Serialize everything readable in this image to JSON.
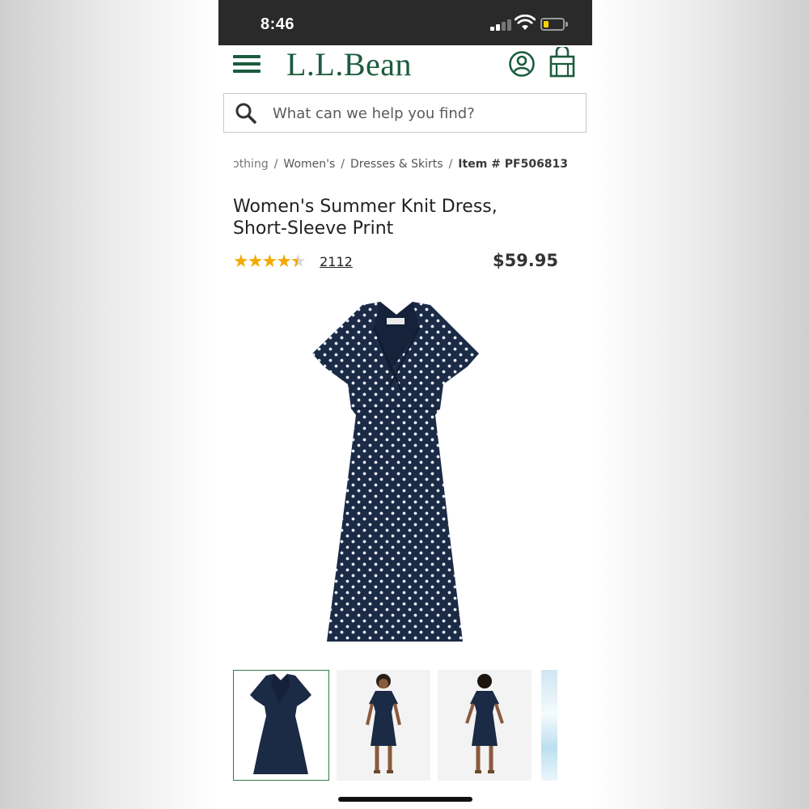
{
  "status_bar": {
    "time": "8:46",
    "icons": [
      "cellular-signal-icon",
      "wifi-icon",
      "battery-low-icon"
    ],
    "battery_level": 0.25,
    "battery_color": "#f5d300"
  },
  "header": {
    "logo": "L.L.Bean",
    "brand_color": "#1c5b3e",
    "icons": [
      "menu-icon",
      "account-icon",
      "shopping-bag-icon"
    ]
  },
  "search": {
    "placeholder": "What can we help you find?"
  },
  "breadcrumb": {
    "items": [
      "ɔthing",
      "Women's",
      "Dresses & Skirts"
    ],
    "current": "Item # PF506813",
    "separator": "/"
  },
  "product": {
    "title_line1": "Women's Summer Knit Dress,",
    "title_line2": "Short-Sleeve Print",
    "rating_value": 4.5,
    "rating_max": 5,
    "review_count": "2112",
    "price": "$59.95",
    "star_color": "#f2a900",
    "dress_color": "#1b2a45"
  },
  "gallery": {
    "selected_index": 0,
    "thumbnails": [
      "dress-flat-thumbnail",
      "model-front-thumbnail",
      "model-back-thumbnail",
      "partial-thumbnail"
    ],
    "selected_border_color": "#2e7d4a"
  }
}
